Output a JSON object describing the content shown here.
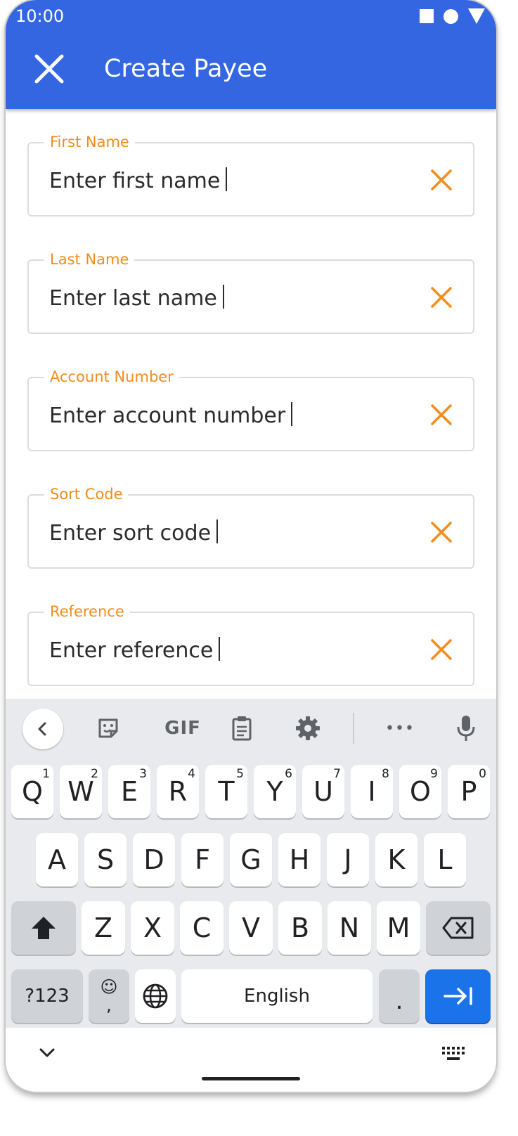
{
  "status_bar": {
    "time": "10:00"
  },
  "header": {
    "title": "Create Payee",
    "close_icon": "close-icon"
  },
  "form": {
    "accent_color": "#f28c1c",
    "fields": [
      {
        "label": "First Name",
        "value": "Enter first name"
      },
      {
        "label": "Last Name",
        "value": "Enter last name"
      },
      {
        "label": "Account Number",
        "value": "Enter account number"
      },
      {
        "label": "Sort Code",
        "value": "Enter sort code"
      },
      {
        "label": "Reference",
        "value": "Enter reference"
      }
    ]
  },
  "keyboard": {
    "toolbar": {
      "gif_label": "GIF",
      "more_label": "•••",
      "icons": [
        "chevron-left-icon",
        "sticker-icon",
        "clipboard-icon",
        "gear-icon",
        "microphone-icon"
      ]
    },
    "row1": [
      {
        "key": "Q",
        "sup": "1"
      },
      {
        "key": "W",
        "sup": "2"
      },
      {
        "key": "E",
        "sup": "3"
      },
      {
        "key": "R",
        "sup": "4"
      },
      {
        "key": "T",
        "sup": "5"
      },
      {
        "key": "Y",
        "sup": "6"
      },
      {
        "key": "U",
        "sup": "7"
      },
      {
        "key": "I",
        "sup": "8"
      },
      {
        "key": "O",
        "sup": "9"
      },
      {
        "key": "P",
        "sup": "0"
      }
    ],
    "row2": [
      "A",
      "S",
      "D",
      "F",
      "G",
      "H",
      "J",
      "K",
      "L"
    ],
    "row3": [
      "Z",
      "X",
      "C",
      "V",
      "B",
      "N",
      "M"
    ],
    "symbols_label": "?123",
    "emoji_label": "☺",
    "comma_label": ",",
    "space_label": "English",
    "period_label": ".",
    "accent_color": "#1a73e8"
  }
}
